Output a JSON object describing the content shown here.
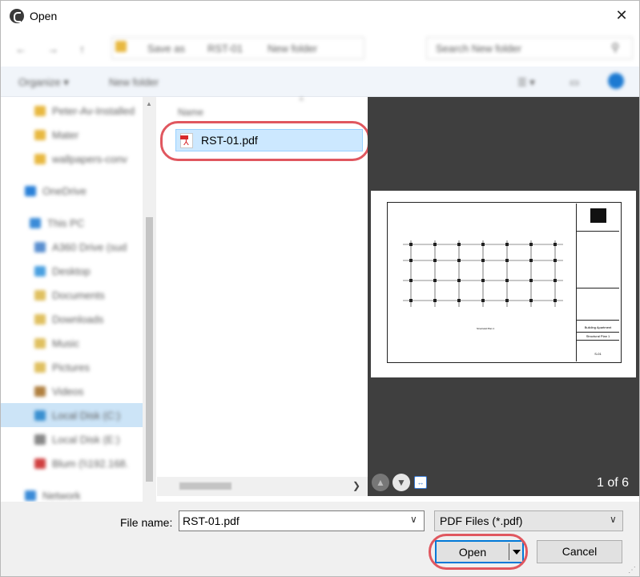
{
  "window": {
    "title": "Open"
  },
  "nav": {
    "breadcrumbs": [
      "Save as",
      "RST-01",
      "New folder"
    ],
    "search_placeholder": "Search New folder"
  },
  "toolbar": {
    "organize": "Organize ▾",
    "new_folder": "New folder"
  },
  "sidebar": {
    "items": [
      {
        "label": "Peter-Av-Installed",
        "icon": "folder-icon",
        "color": "#e8b840"
      },
      {
        "label": "Mater",
        "icon": "folder-icon",
        "color": "#e8b840"
      },
      {
        "label": "wallpapers-conv",
        "icon": "folder-icon",
        "color": "#e8b840"
      },
      {
        "label": "OneDrive",
        "icon": "cloud-icon",
        "color": "#2a80d8"
      },
      {
        "label": "This PC",
        "icon": "computer-icon",
        "color": "#3a8bd8"
      },
      {
        "label": "A360 Drive (sud",
        "icon": "drive-icon",
        "color": "#5a8fd0"
      },
      {
        "label": "Desktop",
        "icon": "desktop-icon",
        "color": "#4aa0e0"
      },
      {
        "label": "Documents",
        "icon": "documents-icon",
        "color": "#e0c060"
      },
      {
        "label": "Downloads",
        "icon": "downloads-icon",
        "color": "#e0c060"
      },
      {
        "label": "Music",
        "icon": "music-icon",
        "color": "#e0c060"
      },
      {
        "label": "Pictures",
        "icon": "pictures-icon",
        "color": "#e0c060"
      },
      {
        "label": "Videos",
        "icon": "videos-icon",
        "color": "#b08040"
      },
      {
        "label": "Local Disk (C:)",
        "icon": "disk-icon",
        "color": "#3a90d0"
      },
      {
        "label": "Local Disk (E:)",
        "icon": "disk-icon",
        "color": "#888888"
      },
      {
        "label": "Blum (\\\\192.168.",
        "icon": "network-drive-icon",
        "color": "#d04040"
      },
      {
        "label": "Network",
        "icon": "network-icon",
        "color": "#3a8bd8"
      }
    ]
  },
  "filelist": {
    "column_header": "Name",
    "files": [
      {
        "name": "RST-01.pdf",
        "icon": "pdf-icon"
      }
    ]
  },
  "preview": {
    "page_count": "1 of 6",
    "titleblock": {
      "project": "Building Apartment",
      "sheet_title": "Structural Plan 1",
      "sheet_number": "S-01"
    },
    "plan_caption": "Structural Plan 1"
  },
  "bottom": {
    "file_name_label": "File name:",
    "file_name_value": "RST-01.pdf",
    "file_type": "PDF Files (*.pdf)",
    "open_label": "Open",
    "cancel_label": "Cancel"
  },
  "colors": {
    "highlight_ring": "#e0575f",
    "selection": "#cce8ff",
    "accent": "#0078d7",
    "preview_bg": "#3f3f3f"
  }
}
